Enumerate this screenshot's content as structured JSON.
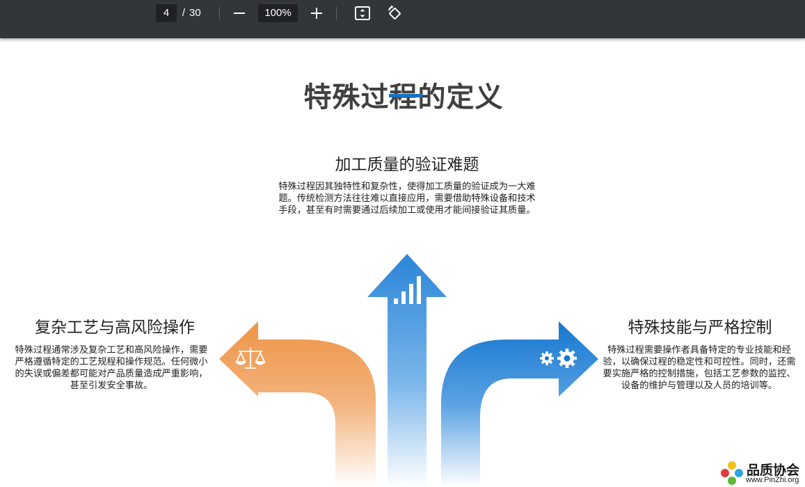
{
  "toolbar": {
    "page_current": "4",
    "page_separator": "/",
    "page_total": "30",
    "zoom": "100%",
    "icons": [
      "minus-icon",
      "plus-icon",
      "fit-page-icon",
      "rotate-icon"
    ]
  },
  "slide": {
    "title": "特殊过程的定义",
    "sections": {
      "top": {
        "title": "加工质量的验证难题",
        "text": "特殊过程因其独特性和复杂性，使得加工质量的验证成为一大难题。传统检测方法往往难以直接应用，需要借助特殊设备和技术手段，甚至有时需要通过后续加工或使用才能间接验证其质量。",
        "icon": "bar-chart-icon",
        "color": "#2b85d8"
      },
      "left": {
        "title": "复杂工艺与高风险操作",
        "text": "特殊过程通常涉及复杂工艺和高风险操作，需要严格遵循特定的工艺规程和操作规范。任何微小的失误或偏差都可能对产品质量造成严重影响，甚至引发安全事故。",
        "icon": "scale-icon",
        "color": "#ee9a4e"
      },
      "right": {
        "title": "特殊技能与严格控制",
        "text": "特殊过程需要操作者具备特定的专业技能和经验，以确保过程的稳定性和可控性。同时，还需要实施严格的控制措施，包括工艺参数的监控、设备的维护与管理以及人员的培训等。",
        "icon": "gears-icon",
        "color": "#1577d0"
      }
    }
  },
  "watermark": {
    "name": "品质协会",
    "url": "www.PinZhi.org"
  }
}
